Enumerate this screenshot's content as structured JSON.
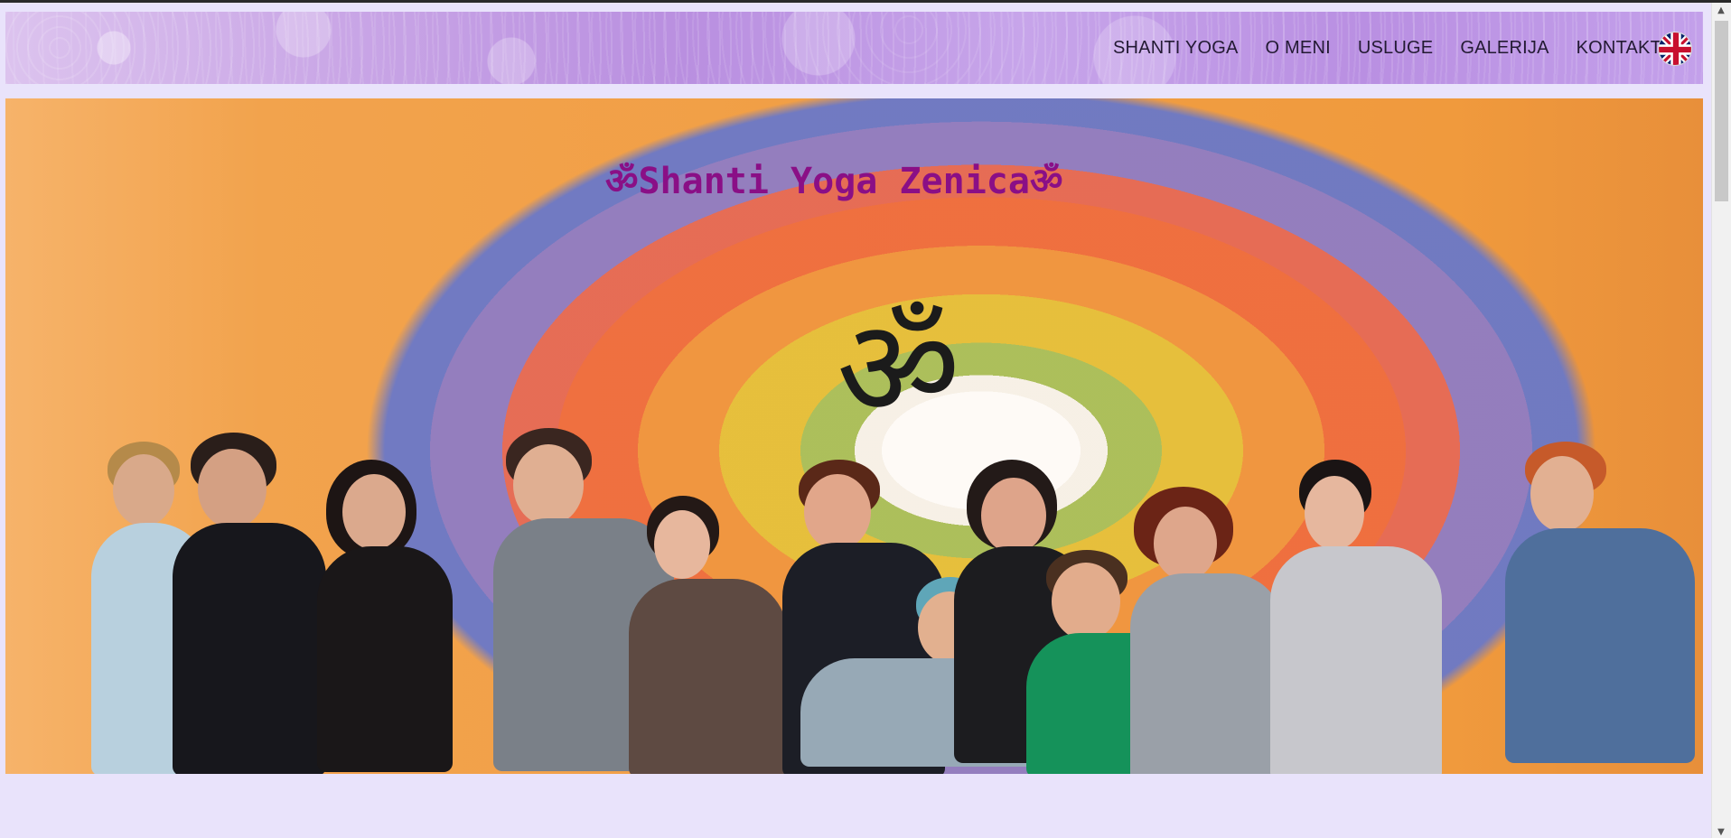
{
  "nav": {
    "items": [
      {
        "label": "SHANTI YOGA"
      },
      {
        "label": "O MENI"
      },
      {
        "label": "USLUGE"
      },
      {
        "label": "GALERIJA"
      },
      {
        "label": "KONTAKT"
      }
    ]
  },
  "language_flag": "uk-flag-icon",
  "hero": {
    "title": "ॐShanti Yoga Zenicaॐ",
    "om_symbol": "ॐ"
  },
  "colors": {
    "background": "#e9e3fb",
    "title": "#8a0f86",
    "nav_text": "#231a33"
  }
}
